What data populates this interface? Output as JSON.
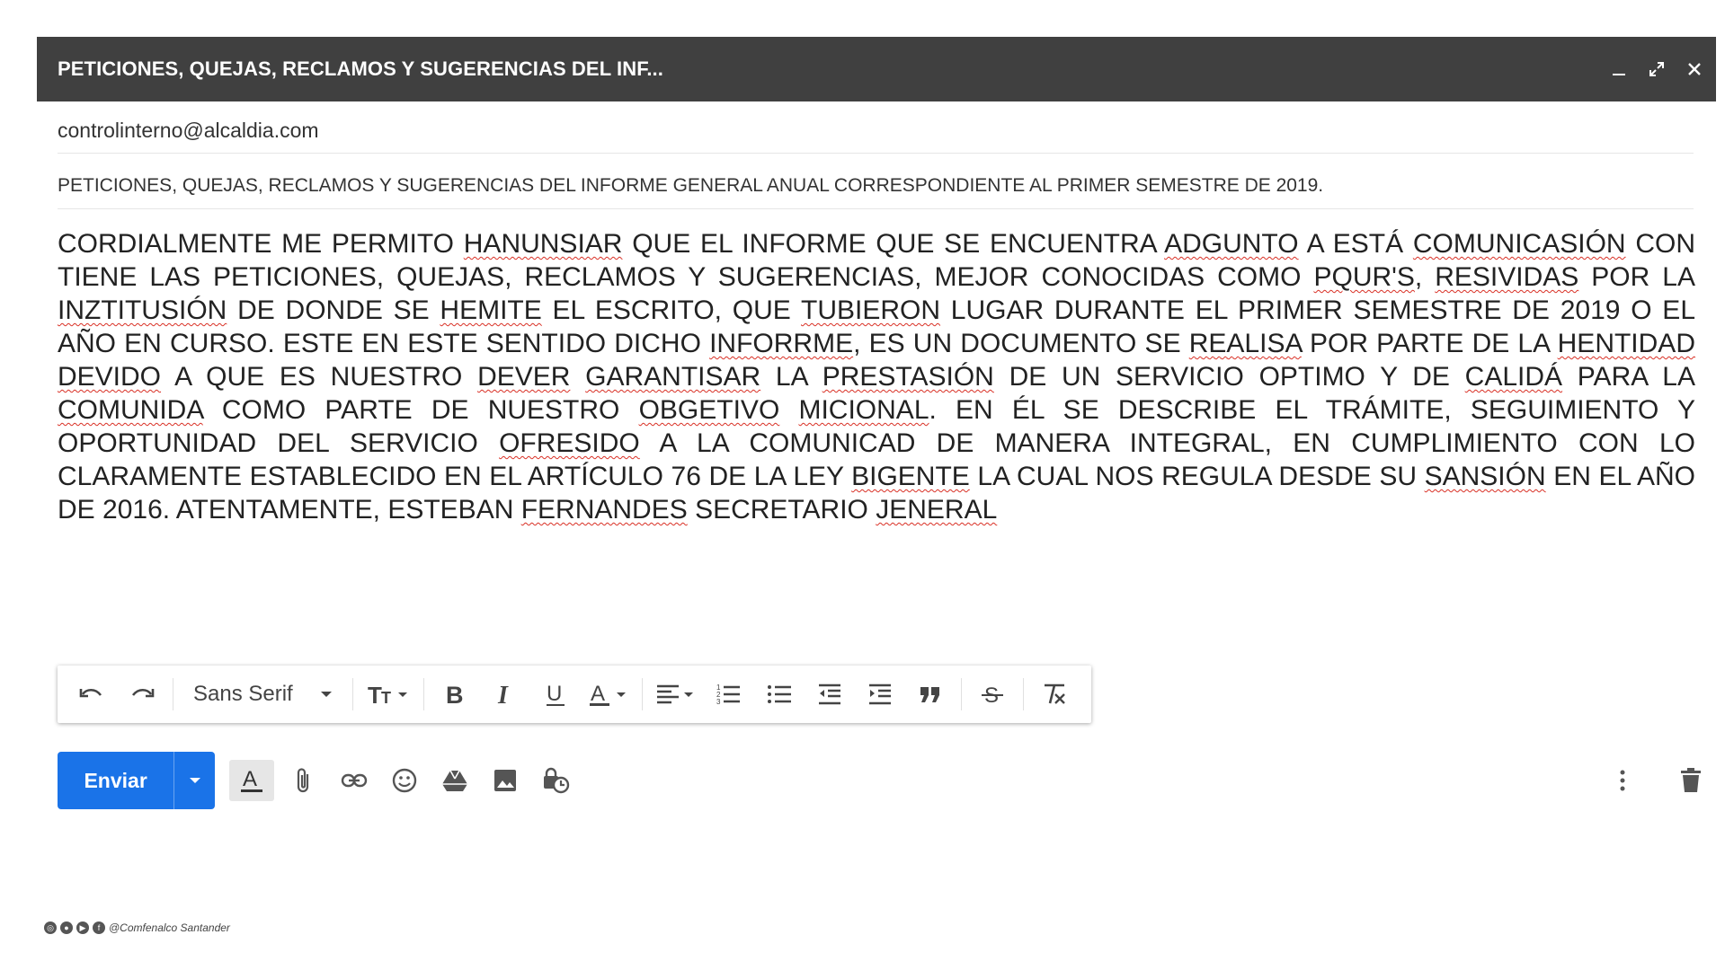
{
  "window": {
    "title": "PETICIONES, QUEJAS, RECLAMOS Y SUGERENCIAS DEL INF...",
    "minimize_icon": "minimize-icon",
    "expand_icon": "expand-icon",
    "close_icon": "close-icon"
  },
  "recipient": "controlinterno@alcaldia.com",
  "subject": "PETICIONES, QUEJAS, RECLAMOS Y SUGERENCIAS DEL INFORME GENERAL ANUAL CORRESPONDIENTE AL PRIMER SEMESTRE DE 2019.",
  "body": {
    "segments": [
      {
        "text": "CORDIALMENTE ME PERMITO ",
        "err": false
      },
      {
        "text": "HANUNSIAR",
        "err": true
      },
      {
        "text": " QUE EL INFORME QUE SE ENCUENTRA ",
        "err": false
      },
      {
        "text": "ADGUNTO",
        "err": true
      },
      {
        "text": " A ESTÁ ",
        "err": false
      },
      {
        "text": "COMUNICASIÓN",
        "err": true
      },
      {
        "text": " CON TIENE LAS PETICIONES, QUEJAS, RECLAMOS Y SUGERENCIAS, MEJOR CONOCIDAS COMO ",
        "err": false
      },
      {
        "text": "PQUR'S",
        "err": true
      },
      {
        "text": ", ",
        "err": false
      },
      {
        "text": "RESIVIDAS",
        "err": true
      },
      {
        "text": " POR LA ",
        "err": false
      },
      {
        "text": "INZTITUSIÓN",
        "err": true
      },
      {
        "text": " DE DONDE SE ",
        "err": false
      },
      {
        "text": "HEMITE",
        "err": true
      },
      {
        "text": " EL ESCRITO, QUE ",
        "err": false
      },
      {
        "text": "TUBIERON",
        "err": true
      },
      {
        "text": " LUGAR DURANTE EL PRIMER SEMESTRE DE 2019 O EL AÑO EN CURSO. ESTE EN ESTE SENTIDO DICHO ",
        "err": false
      },
      {
        "text": "INFORRME",
        "err": true
      },
      {
        "text": ", ES UN DOCUMENTO SE ",
        "err": false
      },
      {
        "text": "REALISA",
        "err": true
      },
      {
        "text": " POR PARTE DE LA ",
        "err": false
      },
      {
        "text": "HENTIDAD",
        "err": true
      },
      {
        "text": " ",
        "err": false
      },
      {
        "text": "DEVIDO",
        "err": true
      },
      {
        "text": " A QUE ES NUESTRO ",
        "err": false
      },
      {
        "text": "DEVER",
        "err": true
      },
      {
        "text": " ",
        "err": false
      },
      {
        "text": "GARANTISAR",
        "err": true
      },
      {
        "text": " LA ",
        "err": false
      },
      {
        "text": "PRESTASIÓN",
        "err": true
      },
      {
        "text": " DE UN SERVICIO OPTIMO Y DE ",
        "err": false
      },
      {
        "text": "CALIDÁ",
        "err": true
      },
      {
        "text": " PARA LA ",
        "err": false
      },
      {
        "text": "COMUNIDA",
        "err": true
      },
      {
        "text": " COMO PARTE DE NUESTRO ",
        "err": false
      },
      {
        "text": "OBGETIVO",
        "err": true
      },
      {
        "text": " ",
        "err": false
      },
      {
        "text": "MICIONAL",
        "err": true
      },
      {
        "text": ". EN ÉL SE DESCRIBE EL TRÁMITE, SEGUIMIENTO Y OPORTUNIDAD DEL SERVICIO ",
        "err": false
      },
      {
        "text": "OFRESIDO",
        "err": true
      },
      {
        "text": " A LA COMUNICAD DE MANERA INTEGRAL, EN CUMPLIMIENTO CON LO CLARAMENTE ESTABLECIDO EN EL ARTÍCULO 76 DE LA LEY ",
        "err": false
      },
      {
        "text": "BIGENTE",
        "err": true
      },
      {
        "text": " LA CUAL NOS REGULA DESDE SU ",
        "err": false
      },
      {
        "text": "SANSIÓN",
        "err": true
      },
      {
        "text": " EN EL AÑO DE 2016. ATENTAMENTE, ESTEBAN ",
        "err": false
      },
      {
        "text": "FERNANDES",
        "err": true
      },
      {
        "text": " SECRETARIO ",
        "err": false
      },
      {
        "text": "JENERAL",
        "err": true
      }
    ]
  },
  "formatting_toolbar": {
    "font_family": "Sans Serif",
    "icons": [
      "undo-icon",
      "redo-icon",
      "font-size-icon",
      "bold-icon",
      "italic-icon",
      "underline-icon",
      "text-color-icon",
      "align-icon",
      "numbered-list-icon",
      "bulleted-list-icon",
      "indent-less-icon",
      "indent-more-icon",
      "quote-icon",
      "strikethrough-icon",
      "remove-formatting-icon"
    ]
  },
  "actions": {
    "send_label": "Enviar",
    "icons": [
      "formatting-options-icon",
      "attach-icon",
      "link-icon",
      "emoji-icon",
      "drive-icon",
      "photo-icon",
      "confidential-mode-icon",
      "more-options-icon",
      "discard-icon"
    ]
  },
  "footer": {
    "handle": "@Comfenalco Santander"
  },
  "colors": {
    "titlebar": "#404040",
    "send_button": "#1a73e8",
    "spellcheck_underline": "#d93025"
  }
}
